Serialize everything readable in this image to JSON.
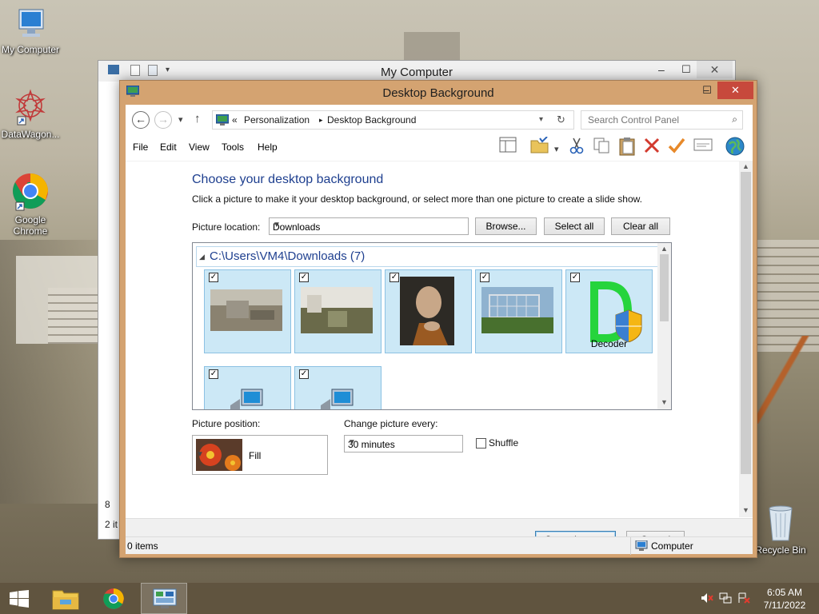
{
  "desktop": {
    "icons": [
      {
        "label": "My Computer"
      },
      {
        "label": "DataWagon..."
      },
      {
        "label": "Google Chrome"
      },
      {
        "label": "Recycle Bin"
      }
    ]
  },
  "back_window": {
    "title": "My Computer",
    "fragments": [
      "8",
      "2 it"
    ]
  },
  "window": {
    "title": "Desktop Background",
    "breadcrumb": {
      "prefix": "«",
      "items": [
        "Personalization",
        "Desktop Background"
      ]
    },
    "search_placeholder": "Search Control Panel",
    "menu": [
      "File",
      "Edit",
      "View",
      "Tools",
      "Help"
    ],
    "heading": "Choose your desktop background",
    "description": "Click a picture to make it your desktop background, or select more than one picture to create a slide show.",
    "picture_location": {
      "label": "Picture location:",
      "value": "Downloads"
    },
    "buttons": {
      "browse": "Browse...",
      "select_all": "Select all",
      "clear_all": "Clear all"
    },
    "group_header": "C:\\Users\\VM4\\Downloads (7)",
    "tiles": [
      {
        "name": "Downloads image 1",
        "checked": true,
        "caption": ""
      },
      {
        "name": "Downloads image 2",
        "checked": true,
        "caption": ""
      },
      {
        "name": "Downloads image 3",
        "checked": true,
        "caption": ""
      },
      {
        "name": "Downloads image 4",
        "checked": true,
        "caption": ""
      },
      {
        "name": "Decoder",
        "checked": true,
        "caption": "Decoder"
      },
      {
        "name": "Downloads item 6",
        "checked": true,
        "caption": ""
      },
      {
        "name": "Downloads item 7",
        "checked": true,
        "caption": ""
      }
    ],
    "picture_position": {
      "label": "Picture position:",
      "value": "Fill"
    },
    "change_picture": {
      "label": "Change picture every:",
      "value": "30 minutes"
    },
    "shuffle": {
      "label": "Shuffle",
      "checked": false
    },
    "save_label": "Save changes",
    "cancel_label": "Cancel",
    "status": {
      "items": "0 items",
      "location": "Computer"
    }
  },
  "taskbar": {
    "time": "6:05 AM",
    "date": "7/11/2022"
  },
  "colors": {
    "title_bar": "#d4a371",
    "heading": "#1e3f8f",
    "tile_selected": "#cce8f6",
    "close_button": "#c7493c"
  }
}
